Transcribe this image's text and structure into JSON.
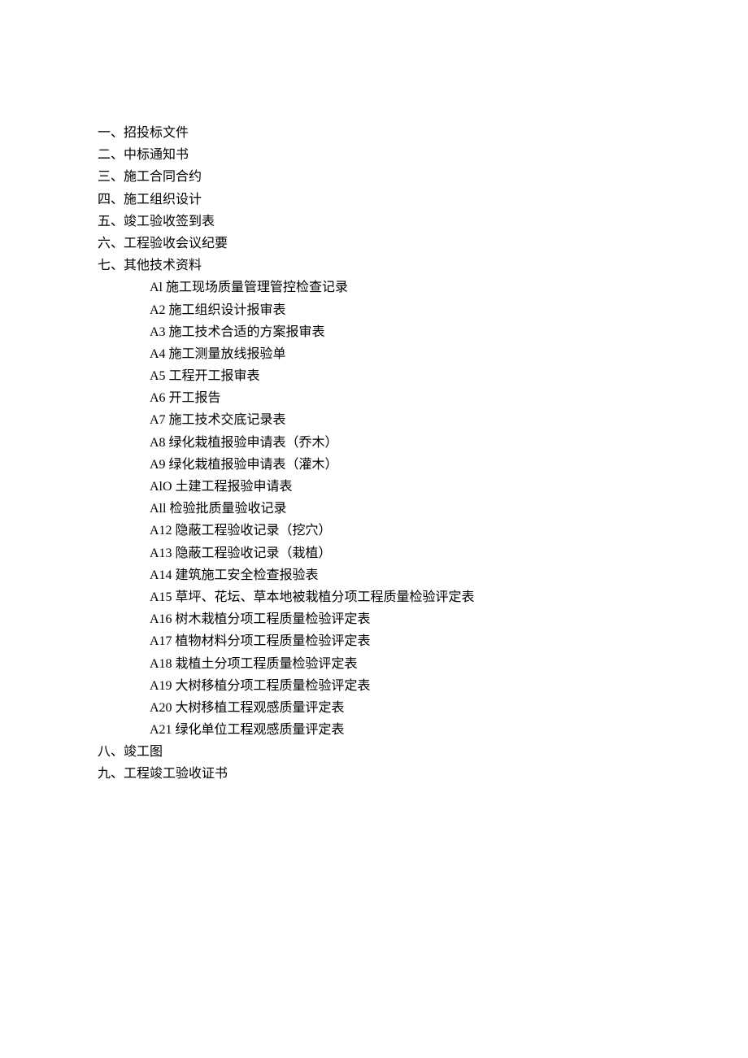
{
  "sections": {
    "s1": "一、招投标文件",
    "s2": "二、中标通知书",
    "s3": "三、施工合同合约",
    "s4": "四、施工组织设计",
    "s5": "五、竣工验收签到表",
    "s6": "六、工程验收会议纪要",
    "s7": "七、其他技术资料",
    "s8": "八、竣工图",
    "s9": "九、工程竣工验收证书"
  },
  "sub_items": {
    "a1": "Al 施工现场质量管理管控检查记录",
    "a2": "A2 施工组织设计报审表",
    "a3": "A3 施工技术合适的方案报审表",
    "a4": "A4 施工测量放线报验单",
    "a5": "A5 工程开工报审表",
    "a6": "A6 开工报告",
    "a7": "A7 施工技术交底记录表",
    "a8": "A8 绿化栽植报验申请表（乔木）",
    "a9": "A9 绿化栽植报验申请表（灌木）",
    "a10": "AlO 土建工程报验申请表",
    "a11": "All 检验批质量验收记录",
    "a12": "A12 隐蔽工程验收记录（挖穴）",
    "a13": "A13 隐蔽工程验收记录（栽植）",
    "a14": "A14 建筑施工安全检查报验表",
    "a15": "A15 草坪、花坛、草本地被栽植分项工程质量检验评定表",
    "a16": "A16 树木栽植分项工程质量检验评定表",
    "a17": "A17 植物材料分项工程质量检验评定表",
    "a18": "A18 栽植土分项工程质量检验评定表",
    "a19": "A19 大树移植分项工程质量检验评定表",
    "a20": "A20 大树移植工程观感质量评定表",
    "a21": "A21 绿化单位工程观感质量评定表"
  }
}
